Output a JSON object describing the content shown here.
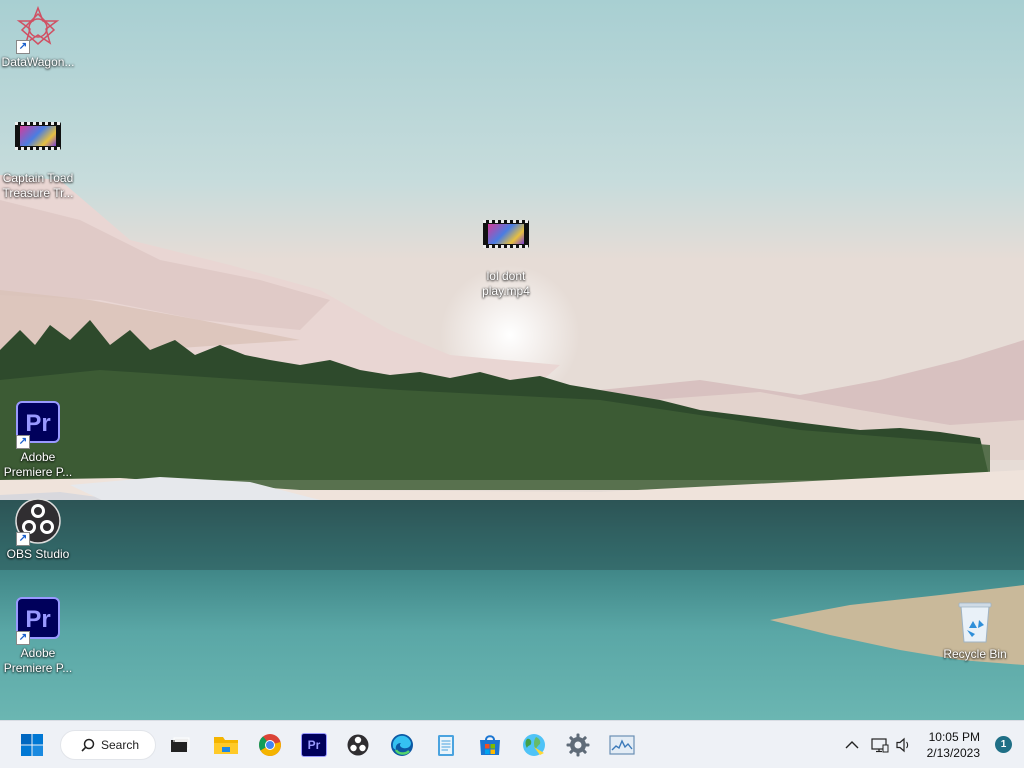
{
  "desktop": {
    "icons": [
      {
        "label": "DataWagon...",
        "icon": "datawagon-icon"
      },
      {
        "label": "Captain Toad Treasure Tr...",
        "icon": "video-file-icon"
      },
      {
        "label": "lol dont play.mp4",
        "icon": "video-file-icon"
      },
      {
        "label": "Adobe Premiere P...",
        "icon": "premiere-pro-icon"
      },
      {
        "label": "OBS Studio",
        "icon": "obs-icon"
      },
      {
        "label": "Adobe Premiere P...",
        "icon": "premiere-pro-icon"
      },
      {
        "label": "Recycle Bin",
        "icon": "recycle-bin-icon"
      }
    ],
    "premiere_glyph": "Pr"
  },
  "taskbar": {
    "search_label": "Search",
    "pinned": [
      {
        "name": "task-view",
        "icon": "task-view-icon"
      },
      {
        "name": "file-explorer",
        "icon": "folder-icon"
      },
      {
        "name": "chrome",
        "icon": "chrome-icon"
      },
      {
        "name": "premiere-pro",
        "icon": "premiere-pro-icon"
      },
      {
        "name": "obs-studio",
        "icon": "obs-icon"
      },
      {
        "name": "edge",
        "icon": "edge-icon"
      },
      {
        "name": "notepad",
        "icon": "notepad-icon"
      },
      {
        "name": "microsoft-store",
        "icon": "store-icon"
      },
      {
        "name": "browser",
        "icon": "globe-icon"
      },
      {
        "name": "settings",
        "icon": "gear-icon"
      },
      {
        "name": "task-manager",
        "icon": "task-manager-icon"
      }
    ],
    "tray": {
      "time": "10:05 PM",
      "date": "2/13/2023",
      "notification_count": "1"
    }
  },
  "colors": {
    "accent": "#0067c0",
    "premiere_bg": "#00005b",
    "premiere_fg": "#9999ff"
  }
}
